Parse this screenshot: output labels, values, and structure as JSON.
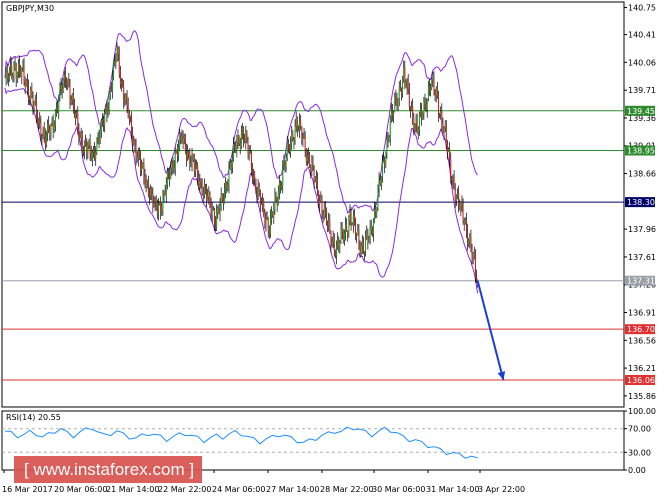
{
  "chart_data": [
    {
      "type": "candlestick",
      "title": "GBPJPY,M30",
      "x_ticks": [
        "16 Mar 2017",
        "20 Mar 06:00",
        "21 Mar 14:00",
        "22 Mar 22:00",
        "24 Mar 06:00",
        "27 Mar 14:00",
        "28 Mar 22:00",
        "30 Mar 06:00",
        "31 Mar 14:00",
        "3 Apr 22:00"
      ],
      "y_ticks": [
        "140.75",
        "140.41",
        "140.06",
        "139.71",
        "139.36",
        "139.01",
        "138.66",
        "137.96",
        "137.61",
        "137.26",
        "136.91",
        "136.56",
        "136.21",
        "135.86"
      ],
      "ylim": [
        135.72,
        140.82
      ],
      "levels": [
        {
          "label": "139.45",
          "value": 139.45,
          "color": "#2e8b2e"
        },
        {
          "label": "138.95",
          "value": 138.95,
          "color": "#2e8b2e"
        },
        {
          "label": "138.30",
          "value": 138.3,
          "color": "#000066"
        },
        {
          "label": "137.31",
          "value": 137.31,
          "color": "#9aa0a8"
        },
        {
          "label": "136.70",
          "value": 136.7,
          "color": "#e03030"
        },
        {
          "label": "136.06",
          "value": 136.06,
          "color": "#e03030"
        }
      ],
      "price_path": [
        [
          0,
          139.8
        ],
        [
          8,
          140.0
        ],
        [
          16,
          139.9
        ],
        [
          24,
          139.6
        ],
        [
          30,
          139.3
        ],
        [
          36,
          139.1
        ],
        [
          42,
          139.25
        ],
        [
          48,
          139.6
        ],
        [
          55,
          139.9
        ],
        [
          62,
          139.4
        ],
        [
          70,
          139.0
        ],
        [
          78,
          138.9
        ],
        [
          86,
          139.2
        ],
        [
          94,
          139.7
        ],
        [
          100,
          140.2
        ],
        [
          104,
          139.8
        ],
        [
          110,
          139.4
        ],
        [
          116,
          139.0
        ],
        [
          122,
          138.7
        ],
        [
          128,
          138.5
        ],
        [
          134,
          138.2
        ],
        [
          140,
          138.3
        ],
        [
          146,
          138.6
        ],
        [
          152,
          138.9
        ],
        [
          158,
          139.1
        ],
        [
          164,
          138.9
        ],
        [
          170,
          138.7
        ],
        [
          176,
          138.5
        ],
        [
          182,
          138.3
        ],
        [
          188,
          138.1
        ],
        [
          194,
          138.3
        ],
        [
          200,
          138.7
        ],
        [
          206,
          139.0
        ],
        [
          212,
          139.2
        ],
        [
          218,
          138.9
        ],
        [
          224,
          138.5
        ],
        [
          230,
          138.2
        ],
        [
          236,
          138.0
        ],
        [
          242,
          138.3
        ],
        [
          248,
          138.7
        ],
        [
          254,
          139.0
        ],
        [
          260,
          139.3
        ],
        [
          266,
          139.1
        ],
        [
          272,
          138.8
        ],
        [
          278,
          138.5
        ],
        [
          284,
          138.2
        ],
        [
          290,
          137.9
        ],
        [
          296,
          137.7
        ],
        [
          302,
          137.9
        ],
        [
          308,
          138.1
        ],
        [
          314,
          137.9
        ],
        [
          320,
          137.7
        ],
        [
          326,
          137.9
        ],
        [
          332,
          138.3
        ],
        [
          338,
          138.8
        ],
        [
          344,
          139.3
        ],
        [
          350,
          139.6
        ],
        [
          356,
          139.9
        ],
        [
          362,
          139.5
        ],
        [
          368,
          139.2
        ],
        [
          374,
          139.5
        ],
        [
          380,
          139.8
        ],
        [
          386,
          139.6
        ],
        [
          392,
          139.2
        ],
        [
          398,
          138.7
        ],
        [
          404,
          138.3
        ],
        [
          410,
          138.1
        ],
        [
          416,
          137.7
        ],
        [
          422,
          137.3
        ]
      ],
      "indicator": {
        "title": "RSI(14) 20.55",
        "ylim": [
          0,
          100
        ],
        "y_ticks": [
          "100.00",
          "70.00",
          "30.00",
          "0.00"
        ],
        "levels": [
          70,
          30
        ],
        "values": [
          66,
          62,
          58,
          60,
          64,
          62,
          56,
          60,
          66,
          70,
          62,
          58,
          64,
          68,
          72,
          64,
          58,
          62,
          66,
          60,
          56,
          54,
          58,
          62,
          60,
          56,
          52,
          56,
          60,
          62,
          58,
          54,
          50,
          54,
          58,
          56,
          60,
          64,
          62,
          56,
          52,
          48,
          52,
          56,
          60,
          58,
          54,
          50,
          46,
          50,
          54,
          58,
          62,
          66,
          64,
          70,
          72,
          68,
          64,
          60,
          64,
          70,
          68,
          62,
          56,
          52,
          50,
          46,
          42,
          38,
          34,
          30,
          28,
          26,
          24,
          22,
          20.55
        ]
      },
      "forecast_arrow": {
        "start": [
          422,
          137.31
        ],
        "end": [
          445,
          136.06
        ],
        "color": "#1a3de0"
      }
    }
  ],
  "watermark": "[ www.instaforex.com ]"
}
